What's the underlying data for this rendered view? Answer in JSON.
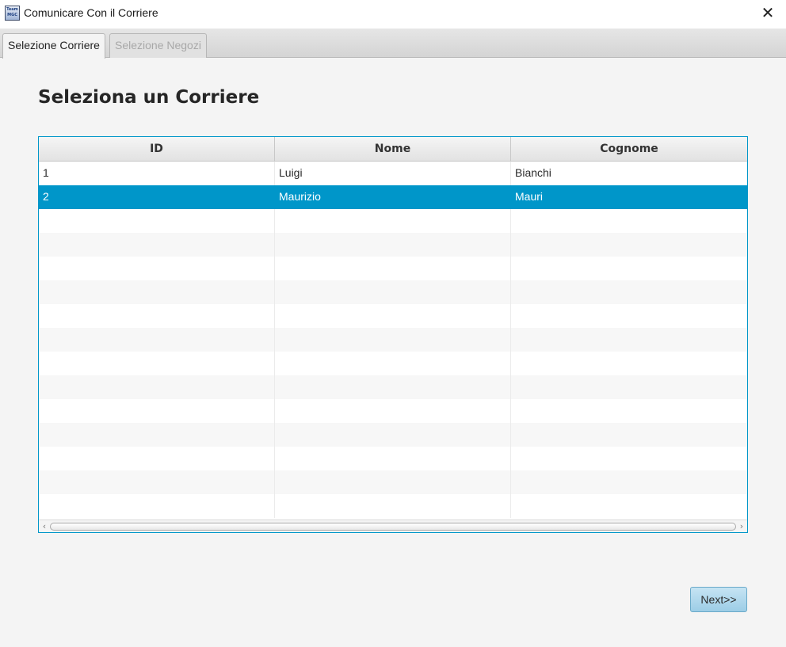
{
  "window": {
    "title": "Comunicare Con il Corriere",
    "icon_text": "Team\nMGC",
    "close_glyph": "✕"
  },
  "tabs": [
    {
      "label": "Selezione Corriere",
      "active": true
    },
    {
      "label": "Selezione Negozi",
      "active": false
    }
  ],
  "main": {
    "heading": "Seleziona un Corriere"
  },
  "table": {
    "columns": [
      "ID",
      "Nome",
      "Cognome"
    ],
    "rows": [
      {
        "id": "1",
        "nome": "Luigi",
        "cognome": "Bianchi",
        "selected": false
      },
      {
        "id": "2",
        "nome": "Maurizio",
        "cognome": "Mauri",
        "selected": true
      }
    ],
    "empty_rows": 13,
    "selection_color": "#0096c9"
  },
  "scrollbar": {
    "left_arrow": "‹",
    "right_arrow": "›"
  },
  "footer": {
    "next_label": "Next>>"
  }
}
